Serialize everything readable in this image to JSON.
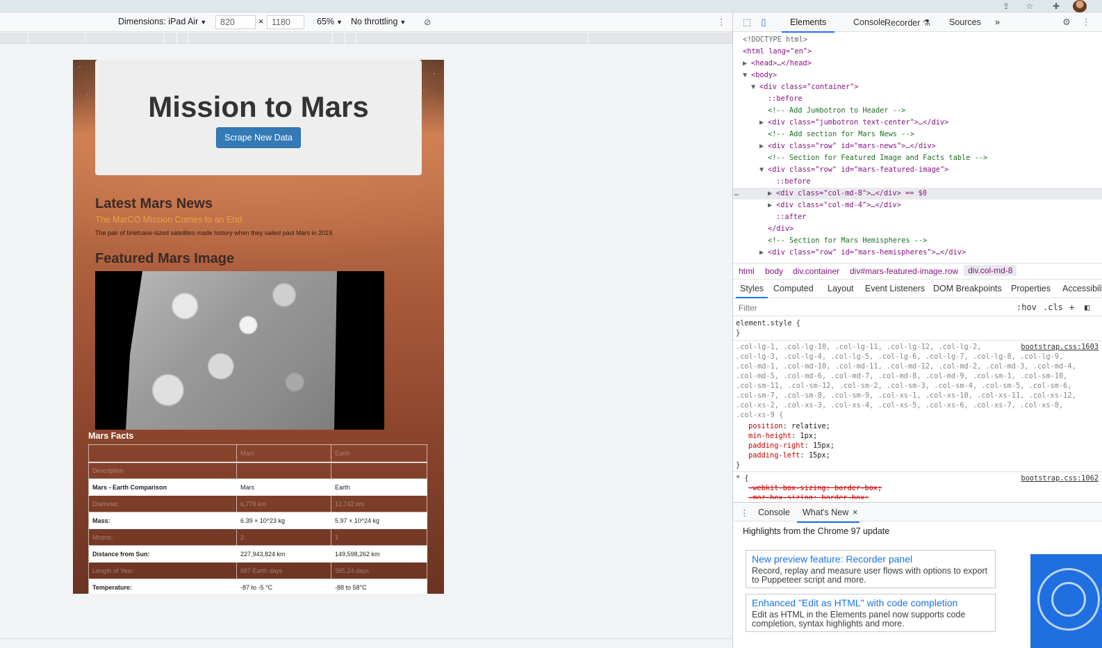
{
  "device_toolbar": {
    "dimensions_label": "Dimensions: iPad Air",
    "width": "820",
    "times": "×",
    "height": "1180",
    "zoom": "65%",
    "throttle": "No throttling"
  },
  "page": {
    "title": "Mission to Mars",
    "scrape_button": "Scrape New Data",
    "news_heading": "Latest Mars News",
    "news_title": "The MarCO Mission Comes to an End",
    "news_paragraph": "The pair of briefcase-sized satellites made history when they sailed past Mars in 2019.",
    "featured_heading": "Featured Mars Image",
    "facts_heading": "Mars Facts",
    "facts_header": [
      "",
      "Mars",
      "Earth"
    ],
    "facts_rows": [
      [
        "Description",
        "",
        ""
      ],
      [
        "Mars - Earth Comparison",
        "Mars",
        "Earth"
      ],
      [
        "Diameter:",
        "6,779 km",
        "12,742 km"
      ],
      [
        "Mass:",
        "6.39 × 10^23 kg",
        "5.97 × 10^24 kg"
      ],
      [
        "Moons:",
        "2",
        "1"
      ],
      [
        "Distance from Sun:",
        "227,943,824 km",
        "149,598,262 km"
      ],
      [
        "Length of Year:",
        "687 Earth days",
        "365.24 days"
      ],
      [
        "Temperature:",
        "-87 to -5 °C",
        "-88 to 58°C"
      ]
    ]
  },
  "devtools": {
    "tabs": [
      "Elements",
      "Console",
      "Recorder",
      "Sources"
    ],
    "more": "»",
    "elements": [
      {
        "indent": 0,
        "tri": "",
        "html": "<!DOCTYPE html>"
      },
      {
        "indent": 0,
        "tri": "",
        "html": "<html lang=\"en\">"
      },
      {
        "indent": 0,
        "tri": "▶",
        "html": "<head>…</head>"
      },
      {
        "indent": 0,
        "tri": "▼",
        "html": "<body>"
      },
      {
        "indent": 1,
        "tri": "▼",
        "html": "<div class=\"container\">"
      },
      {
        "indent": 2,
        "tri": "",
        "html": "::before"
      },
      {
        "indent": 2,
        "tri": "",
        "html": "<!-- Add Jumbotron to Header -->"
      },
      {
        "indent": 2,
        "tri": "▶",
        "html": "<div class=\"jumbotron text-center\">…</div>"
      },
      {
        "indent": 2,
        "tri": "",
        "html": "<!-- Add section for Mars News -->"
      },
      {
        "indent": 2,
        "tri": "▶",
        "html": "<div class=\"row\" id=\"mars-news\">…</div>"
      },
      {
        "indent": 2,
        "tri": "",
        "html": "<!-- Section for Featured Image and Facts table -->"
      },
      {
        "indent": 2,
        "tri": "▼",
        "html": "<div class=\"row\" id=\"mars-featured-image\">"
      },
      {
        "indent": 3,
        "tri": "",
        "html": "::before"
      },
      {
        "indent": 3,
        "tri": "▶",
        "html": "<div class=\"col-md-8\">…</div> == $0"
      },
      {
        "indent": 3,
        "tri": "▶",
        "html": "<div class=\"col-md-4\">…</div>"
      },
      {
        "indent": 3,
        "tri": "",
        "html": "::after"
      },
      {
        "indent": 2,
        "tri": "",
        "html": "</div>"
      },
      {
        "indent": 2,
        "tri": "",
        "html": "<!-- Section for Mars Hemispheres -->"
      },
      {
        "indent": 2,
        "tri": "▶",
        "html": "<div class=\"row\" id=\"mars-hemispheres\">…</div>"
      }
    ],
    "selected_line": "…",
    "breadcrumbs": [
      "html",
      "body",
      "div.container",
      "div#mars-featured-image.row",
      "div.col-md-8"
    ],
    "sub_tabs": [
      "Styles",
      "Computed",
      "Layout",
      "Event Listeners",
      "DOM Breakpoints",
      "Properties",
      "Accessibili"
    ],
    "filter_placeholder": "Filter",
    "filter_hov": ":hov",
    "filter_cls": ".cls",
    "filter_plus": "+",
    "styles": {
      "element_style_open": "element.style {",
      "close": "}",
      "selector_lines": [
        ".col-lg-1, .col-lg-10, .col-lg-11, .col-lg-12, .col-lg-2,",
        ".col-lg-3, .col-lg-4, .col-lg-5, .col-lg-6, .col-lg-7, .col-lg-8, .col-lg-9,",
        ".col-md-1, .col-md-10, .col-md-11, .col-md-12, .col-md-2, .col-md-3, .col-md-4,",
        ".col-md-5, .col-md-6, .col-md-7, .col-md-8, .col-md-9, .col-sm-1, .col-sm-10,",
        ".col-sm-11, .col-sm-12, .col-sm-2, .col-sm-3, .col-sm-4, .col-sm-5, .col-sm-6,",
        ".col-sm-7, .col-sm-8, .col-sm-9, .col-xs-1, .col-xs-10, .col-xs-11, .col-xs-12,",
        ".col-xs-2, .col-xs-3, .col-xs-4, .col-xs-5, .col-xs-6, .col-xs-7, .col-xs-8,",
        ".col-xs-9 {"
      ],
      "source1": "bootstrap.css:1603",
      "decls": [
        {
          "p": "position",
          "v": "relative;"
        },
        {
          "p": "min-height",
          "v": "1px;"
        },
        {
          "p": "padding-right",
          "v": "15px;"
        },
        {
          "p": "padding-left",
          "v": "15px;"
        }
      ],
      "star_rule": "* {",
      "source2": "bootstrap.css:1062",
      "strike1": "-webkit-box-sizing: border-box;",
      "strike2": "-moz-box-sizing: border-box;"
    },
    "drawer_tabs": [
      "Console",
      "What's New"
    ],
    "drawer_close": "×",
    "whats_new_heading": "Highlights from the Chrome 97 update",
    "cards": [
      {
        "title": "New preview feature: Recorder panel",
        "desc": "Record, replay and measure user flows with options to export to Puppeteer script and more."
      },
      {
        "title": "Enhanced \"Edit as HTML\" with code completion",
        "desc": "Edit as HTML in the Elements panel now supports code completion, syntax highlights and more."
      }
    ]
  },
  "colors": {
    "accent": "#1a73e8",
    "button": "#337ab7",
    "news_title": "#f0a040"
  }
}
